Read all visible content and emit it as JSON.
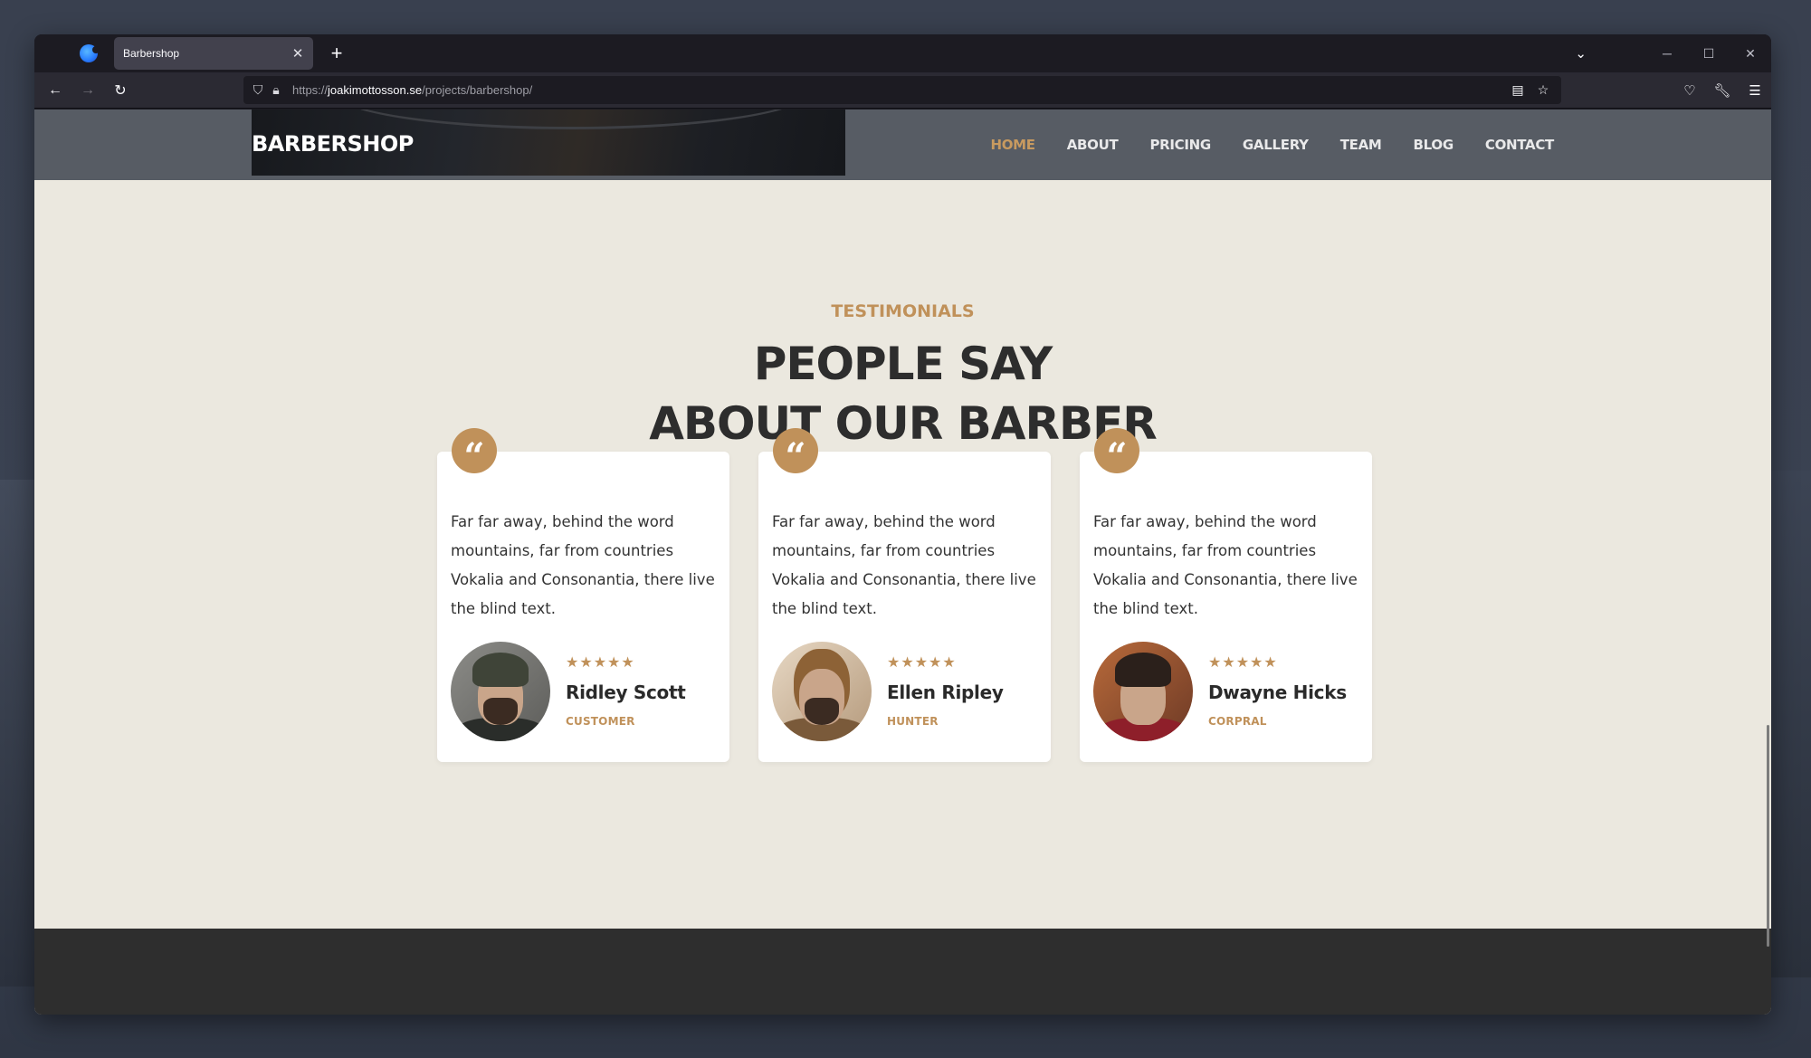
{
  "browser": {
    "tab_title": "Barbershop",
    "url_scheme": "https://",
    "url_host": "joakimottosson.se",
    "url_path": "/projects/barbershop/"
  },
  "site": {
    "brand": "BARBERSHOP",
    "nav": [
      "HOME",
      "ABOUT",
      "PRICING",
      "GALLERY",
      "TEAM",
      "BLOG",
      "CONTACT"
    ],
    "active_nav": "HOME"
  },
  "testimonials": {
    "label": "TESTIMONIALS",
    "heading_line1": "PEOPLE SAY",
    "heading_line2": "ABOUT OUR BARBER",
    "items": [
      {
        "quote": "Far far away, behind the word mountains, far from countries Vokalia and Consonantia, there live the blind text.",
        "rating": 5,
        "stars": "★★★★★",
        "name": "Ridley Scott",
        "role": "CUSTOMER"
      },
      {
        "quote": "Far far away, behind the word mountains, far from countries Vokalia and Consonantia, there live the blind text.",
        "rating": 5,
        "stars": "★★★★★",
        "name": "Ellen Ripley",
        "role": "HUNTER"
      },
      {
        "quote": "Far far away, behind the word mountains, far from countries Vokalia and Consonantia, there live the blind text.",
        "rating": 5,
        "stars": "★★★★★",
        "name": "Dwayne Hicks",
        "role": "CORPRAL"
      }
    ]
  },
  "colors": {
    "accent": "#c0915a",
    "page_bg": "#ebe8df",
    "header_bg": "#575c64",
    "footer_bg": "#2e2e2e"
  }
}
